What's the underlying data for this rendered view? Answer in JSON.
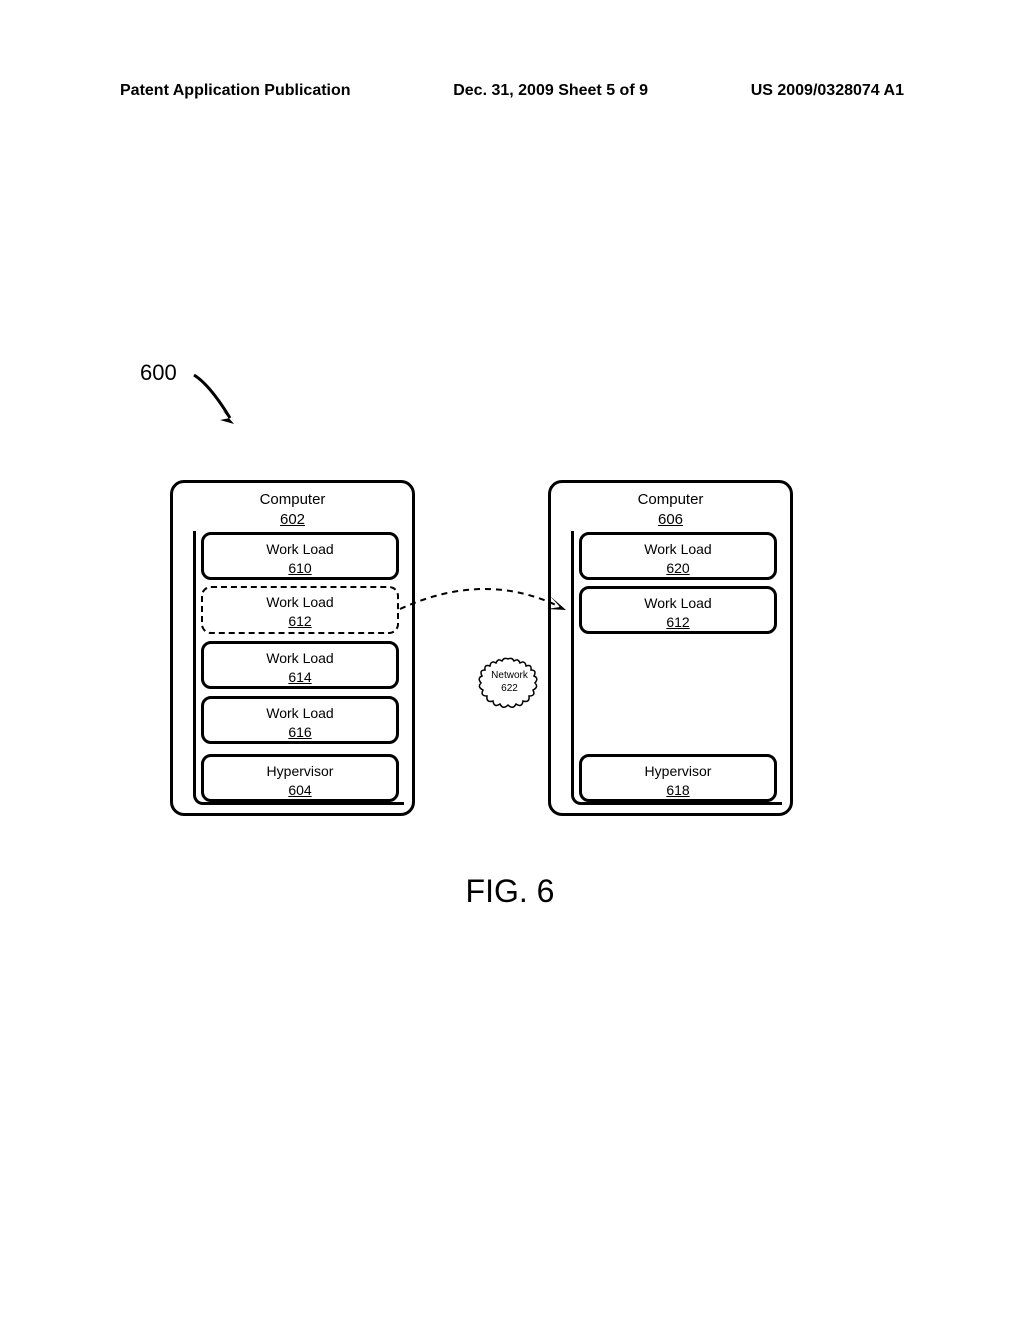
{
  "header": {
    "left": "Patent Application Publication",
    "center": "Dec. 31, 2009  Sheet 5 of 9",
    "right": "US 2009/0328074 A1"
  },
  "figure": {
    "number": "600",
    "label": "FIG. 6",
    "computer_left": {
      "title": "Computer",
      "ref": "602",
      "workloads": [
        {
          "title": "Work Load",
          "ref": "610"
        },
        {
          "title": "Work Load",
          "ref": "612"
        },
        {
          "title": "Work Load",
          "ref": "614"
        },
        {
          "title": "Work Load",
          "ref": "616"
        }
      ],
      "hypervisor": {
        "title": "Hypervisor",
        "ref": "604"
      }
    },
    "computer_right": {
      "title": "Computer",
      "ref": "606",
      "workloads": [
        {
          "title": "Work Load",
          "ref": "620"
        },
        {
          "title": "Work Load",
          "ref": "612"
        }
      ],
      "hypervisor": {
        "title": "Hypervisor",
        "ref": "618"
      }
    },
    "network": {
      "title": "Network",
      "ref": "622"
    }
  }
}
